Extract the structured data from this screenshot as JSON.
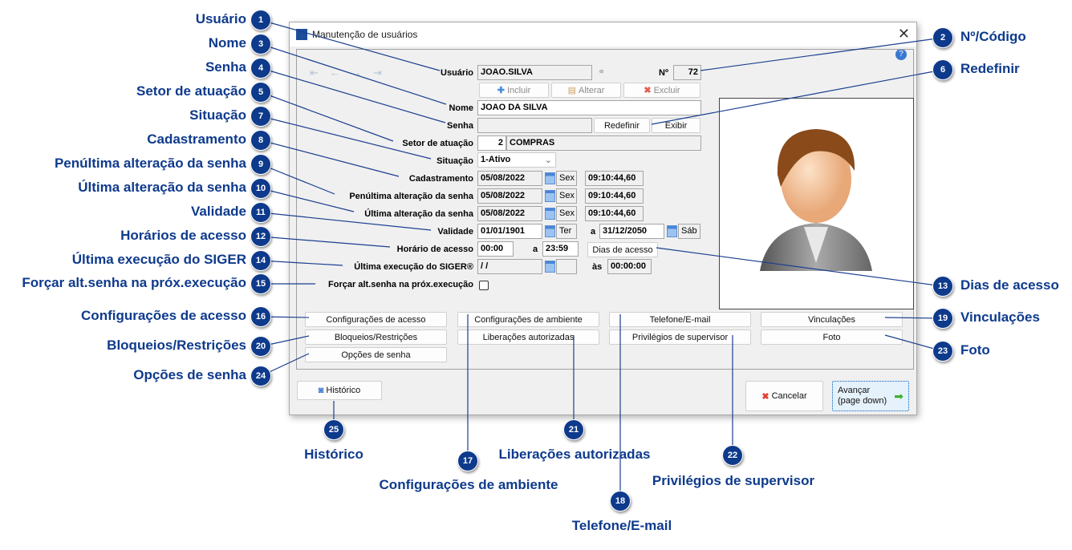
{
  "window": {
    "title": "Manutenção de usuários",
    "close_icon": "close-icon"
  },
  "form": {
    "usuario": {
      "label": "Usuário",
      "value": "JOAO.SILVA"
    },
    "numero": {
      "label": "Nº",
      "value": "72"
    },
    "actions": {
      "incluir": "Incluir",
      "alterar": "Alterar",
      "excluir": "Excluir"
    },
    "nome": {
      "label": "Nome",
      "value": "JOAO DA SILVA"
    },
    "senha": {
      "label": "Senha",
      "value": "",
      "redefinir": "Redefinir",
      "exibir": "Exibir"
    },
    "setor": {
      "label": "Setor de atuação",
      "code": "2",
      "name": "COMPRAS"
    },
    "situacao": {
      "label": "Situação",
      "value": "1-Ativo"
    },
    "cadastramento": {
      "label": "Cadastramento",
      "date": "05/08/2022",
      "day": "Sex",
      "time": "09:10:44,60"
    },
    "penultima": {
      "label": "Penúltima alteração da senha",
      "date": "05/08/2022",
      "day": "Sex",
      "time": "09:10:44,60"
    },
    "ultima": {
      "label": "Última alteração da senha",
      "date": "05/08/2022",
      "day": "Sex",
      "time": "09:10:44,60"
    },
    "validade": {
      "label": "Validade",
      "from": "01/01/1901",
      "from_day": "Ter",
      "sep": "a",
      "to": "31/12/2050",
      "to_day": "Sáb"
    },
    "horario": {
      "label": "Horário de acesso",
      "from": "00:00",
      "sep": "a",
      "to": "23:59",
      "dias": "Dias de acesso"
    },
    "execucao": {
      "label": "Última execução do SIGER®",
      "date": " /  /",
      "day": "",
      "sep": "às",
      "time": "00:00:00"
    },
    "forcar": {
      "label": "Forçar alt.senha na próx.execução",
      "checked": false
    },
    "buttons": [
      "Configurações de acesso",
      "Configurações de ambiente",
      "Telefone/E-mail",
      "Vinculações",
      "Bloqueios/Restrições",
      "Liberações autorizadas",
      "Privilégios de supervisor",
      "Foto",
      "Opções de senha"
    ]
  },
  "footer": {
    "historico": "Histórico",
    "cancelar": "Cancelar",
    "avancar1": "Avançar",
    "avancar2": "(page down)"
  },
  "callouts": [
    {
      "n": "1",
      "text": "Usuário"
    },
    {
      "n": "2",
      "text": "Nº/Código"
    },
    {
      "n": "3",
      "text": "Nome"
    },
    {
      "n": "4",
      "text": "Senha"
    },
    {
      "n": "5",
      "text": "Setor de atuação"
    },
    {
      "n": "6",
      "text": "Redefinir"
    },
    {
      "n": "7",
      "text": "Situação"
    },
    {
      "n": "8",
      "text": "Cadastramento"
    },
    {
      "n": "9",
      "text": "Penúltima alteração da senha"
    },
    {
      "n": "10",
      "text": "Última alteração da senha"
    },
    {
      "n": "11",
      "text": "Validade"
    },
    {
      "n": "12",
      "text": "Horários de acesso"
    },
    {
      "n": "13",
      "text": "Dias de acesso"
    },
    {
      "n": "14",
      "text": "Última execução do SIGER"
    },
    {
      "n": "15",
      "text": "Forçar alt.senha na próx.execução"
    },
    {
      "n": "16",
      "text": "Configurações de acesso"
    },
    {
      "n": "17",
      "text": "Configurações de ambiente"
    },
    {
      "n": "18",
      "text": "Telefone/E-mail"
    },
    {
      "n": "19",
      "text": "Vinculações"
    },
    {
      "n": "20",
      "text": "Bloqueios/Restrições"
    },
    {
      "n": "21",
      "text": "Liberações autorizadas"
    },
    {
      "n": "22",
      "text": "Privilégios de supervisor"
    },
    {
      "n": "23",
      "text": "Foto"
    },
    {
      "n": "24",
      "text": "Opções de senha"
    },
    {
      "n": "25",
      "text": "Histórico"
    }
  ]
}
